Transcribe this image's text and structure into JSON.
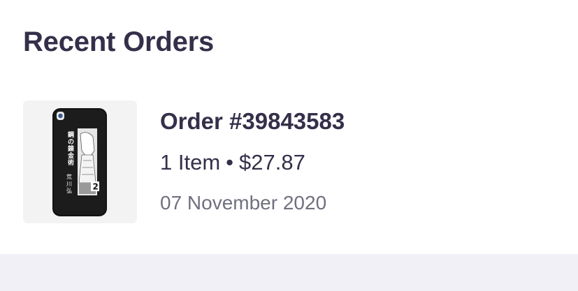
{
  "section": {
    "title": "Recent Orders"
  },
  "orders": [
    {
      "number": "Order #39843583",
      "item_count": "1 Item",
      "separator": "•",
      "total": "$27.87",
      "date": "07 November 2020",
      "thumbnail": {
        "icon": "phone-case-image",
        "text_title": "鋼の錬金術師",
        "text_volume": "2",
        "text_author": "荒川弘"
      }
    }
  ],
  "colors": {
    "title_text": "#352f4a",
    "secondary_text": "#707080",
    "thumb_bg": "#f3f3f3",
    "footer_bg": "#f0f0f6"
  }
}
